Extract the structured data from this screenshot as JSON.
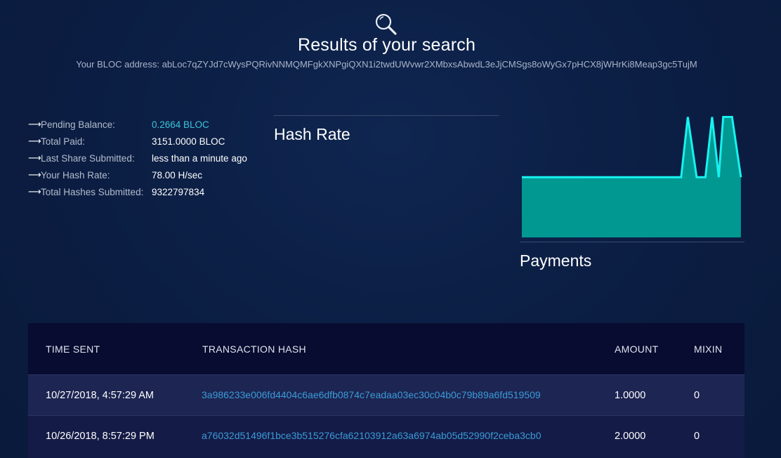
{
  "header": {
    "title": "Results of your search",
    "address_line": "Your BLOC address: abLoc7qZYJd7cWysPQRivNNMQMFgkXNPgiQXN1i2twdUWvwr2XMbxsAbwdL3eJjCMSgs8oWyGx7pHCX8jWHrKi8Meap3gc5TujM"
  },
  "stats": [
    {
      "label": "Pending Balance:",
      "value": "0.2664 BLOC"
    },
    {
      "label": "Total Paid:",
      "value": "3151.0000 BLOC"
    },
    {
      "label": "Last Share Submitted:",
      "value": "less than a minute ago"
    },
    {
      "label": "Your Hash Rate:",
      "value": "78.00 H/sec"
    },
    {
      "label": "Total Hashes Submitted:",
      "value": "9322797834"
    }
  ],
  "hash_rate": {
    "title": "Hash Rate"
  },
  "payments": {
    "title": "Payments"
  },
  "chart_data": {
    "type": "area",
    "title": "",
    "xlabel": "",
    "ylabel": "",
    "values": [
      1,
      1,
      1,
      1,
      1,
      1,
      1,
      1,
      1,
      1,
      1,
      1,
      1,
      1,
      1,
      1,
      1,
      1,
      1,
      1,
      1,
      1,
      1,
      1,
      1,
      1,
      1,
      1,
      1,
      1,
      1,
      1,
      1,
      1,
      1,
      1,
      1,
      1,
      1,
      1,
      1,
      1,
      1,
      1,
      1,
      1,
      1,
      1,
      1,
      1,
      1,
      1,
      1,
      1,
      1,
      1,
      1,
      1,
      1,
      1,
      1,
      1,
      1,
      1,
      1,
      1,
      1,
      1,
      1,
      1,
      1,
      1,
      1,
      1,
      1,
      1,
      1,
      1,
      1,
      1,
      1,
      1,
      1,
      1,
      1,
      1,
      1,
      1,
      1,
      1,
      1,
      1,
      1,
      1,
      1,
      1,
      1,
      1,
      1,
      1,
      1,
      1,
      1,
      1,
      1,
      1,
      1,
      1,
      1,
      1,
      1,
      1,
      1,
      1,
      1,
      1,
      1,
      1,
      1,
      1,
      1,
      1,
      1,
      1,
      1,
      1,
      1,
      1,
      1,
      1,
      1,
      1,
      1,
      1,
      1,
      1,
      1,
      1,
      1,
      1,
      1,
      1,
      1,
      1,
      1,
      1,
      1,
      1,
      1,
      1,
      1,
      1,
      1,
      1,
      1,
      1,
      1,
      1,
      1,
      1,
      1,
      1,
      1,
      1,
      1,
      1,
      1,
      1,
      1,
      1,
      1,
      1,
      1,
      1,
      1,
      1,
      1,
      1,
      1,
      1,
      1,
      1,
      1,
      1,
      1,
      1,
      1,
      1,
      1,
      1,
      1,
      1,
      1,
      1,
      1,
      1,
      1,
      1,
      1,
      1,
      1,
      1,
      1,
      1,
      1,
      1,
      1,
      1,
      1,
      1,
      1,
      1,
      1,
      1,
      1,
      1,
      1,
      1,
      1,
      1,
      1,
      1,
      1,
      1,
      1,
      1,
      1,
      1,
      1,
      1,
      1,
      1,
      1,
      1,
      1,
      1,
      1,
      1,
      1,
      1,
      1,
      1,
      1,
      1,
      1,
      1,
      1,
      1,
      1,
      1,
      1,
      1,
      1,
      1,
      1,
      1,
      1,
      1,
      1,
      1,
      1,
      1,
      1,
      1,
      1,
      1,
      1,
      1,
      1,
      1,
      1,
      1,
      1,
      1,
      1,
      1,
      1,
      1,
      1,
      1,
      1,
      1,
      1,
      1,
      1,
      1,
      1,
      1,
      1,
      1,
      1,
      1,
      1,
      1,
      1,
      1,
      1,
      1,
      1,
      1,
      1
    ],
    "series_shape": [
      [
        0,
        1
      ],
      [
        72,
        1
      ],
      [
        75,
        2
      ],
      [
        79,
        1
      ],
      [
        83,
        1
      ],
      [
        86,
        2
      ],
      [
        89,
        1
      ],
      [
        91,
        2
      ],
      [
        95,
        2
      ],
      [
        99,
        1
      ]
    ],
    "ylim": [
      0,
      2
    ],
    "xlim": [
      0,
      100
    ],
    "grid": false,
    "legend": "none",
    "colors": {
      "fill": "#009891",
      "line": "#17f2ef"
    }
  },
  "table": {
    "headers": {
      "time": "TIME SENT",
      "hash": "TRANSACTION HASH",
      "amount": "AMOUNT",
      "mixin": "MIXIN"
    },
    "rows": [
      {
        "time": "10/27/2018, 4:57:29 AM",
        "hash": "3a986233e006fd4404c6ae6dfb0874c7eadaa03ec30c04b0c79b89a6fd519509",
        "amount": "1.0000",
        "mixin": "0"
      },
      {
        "time": "10/26/2018, 8:57:29 PM",
        "hash": "a76032d51496f1bce3b515276cfa62103912a63a6974ab05d52990f2ceba3cb0",
        "amount": "2.0000",
        "mixin": "0"
      }
    ]
  },
  "colors": {
    "background": "#0b1d42",
    "accent": "#3cc3dc",
    "link": "#3a9bd8",
    "table_header": "#070c30"
  }
}
